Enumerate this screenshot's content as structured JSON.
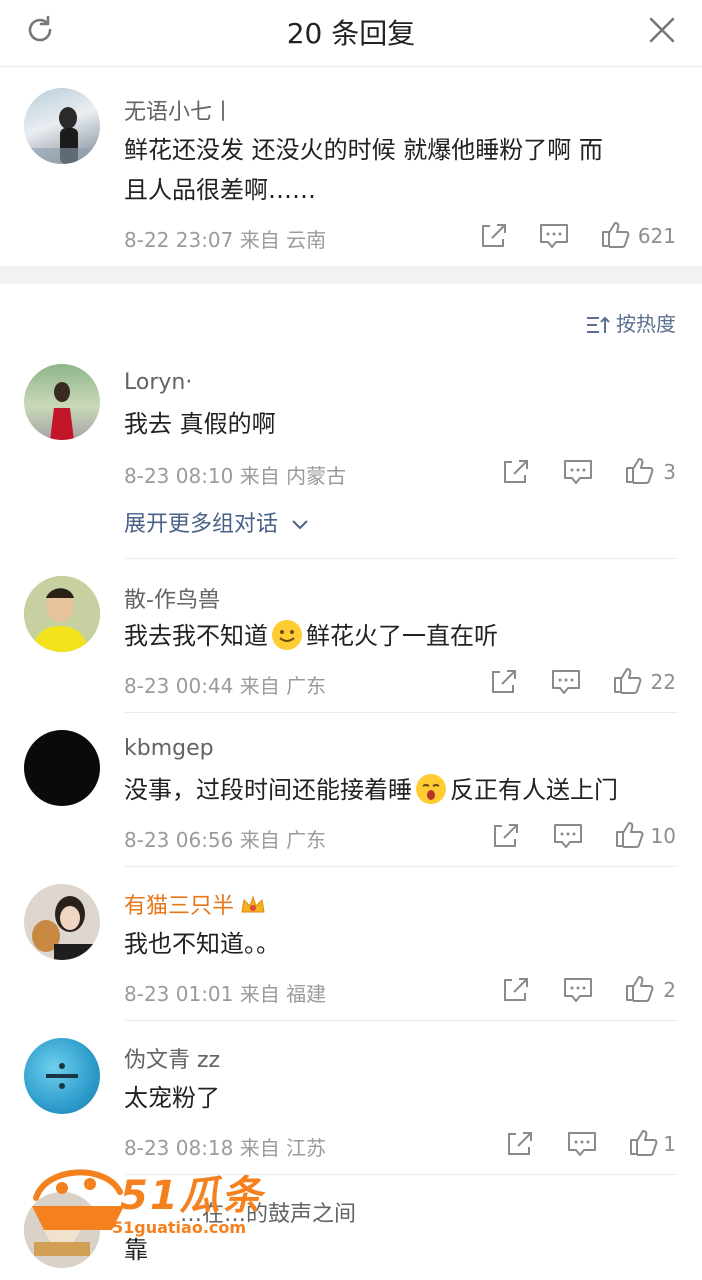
{
  "header": {
    "title": "20 条回复"
  },
  "root": {
    "username": "无语小七丨",
    "text_line1": "鲜花还没发 还没火的时候 就爆他睡粉了啊 而",
    "text_line2": "且人品很差啊……",
    "meta": "8-22 23:07  来自 云南",
    "likes": "621"
  },
  "sort_label": "按热度",
  "expand_label": "展开更多组对话",
  "replies": [
    {
      "username": "Loryn·",
      "text": "我去 真假的啊",
      "meta": "8-23 08:10  来自 内蒙古",
      "likes": "3"
    },
    {
      "username": "散-作鸟兽",
      "text_a": "我去我不知道",
      "text_b": "鲜花火了一直在听",
      "meta": "8-23 00:44  来自 广东",
      "likes": "22"
    },
    {
      "username": "kbmgep",
      "text_a": "没事，过段时间还能接着睡",
      "text_b": "反正有人送上门",
      "meta": "8-23 06:56  来自 广东",
      "likes": "10"
    },
    {
      "username": "有猫三只半",
      "text": "我也不知道。。",
      "meta": "8-23 01:01  来自 福建",
      "likes": "2"
    },
    {
      "username": "伪文青 zz",
      "text": "太宠粉了",
      "meta": "8-23 08:18  来自 江苏",
      "likes": "1"
    },
    {
      "username": "…在…的鼓声之间",
      "text": "靠"
    }
  ],
  "watermark": {
    "brand": "51瓜条",
    "url": "51guatiao.com"
  },
  "colors": {
    "accent_orange": "#f5801e",
    "link_blue": "#4a6188",
    "vip_name": "#e8771a"
  }
}
